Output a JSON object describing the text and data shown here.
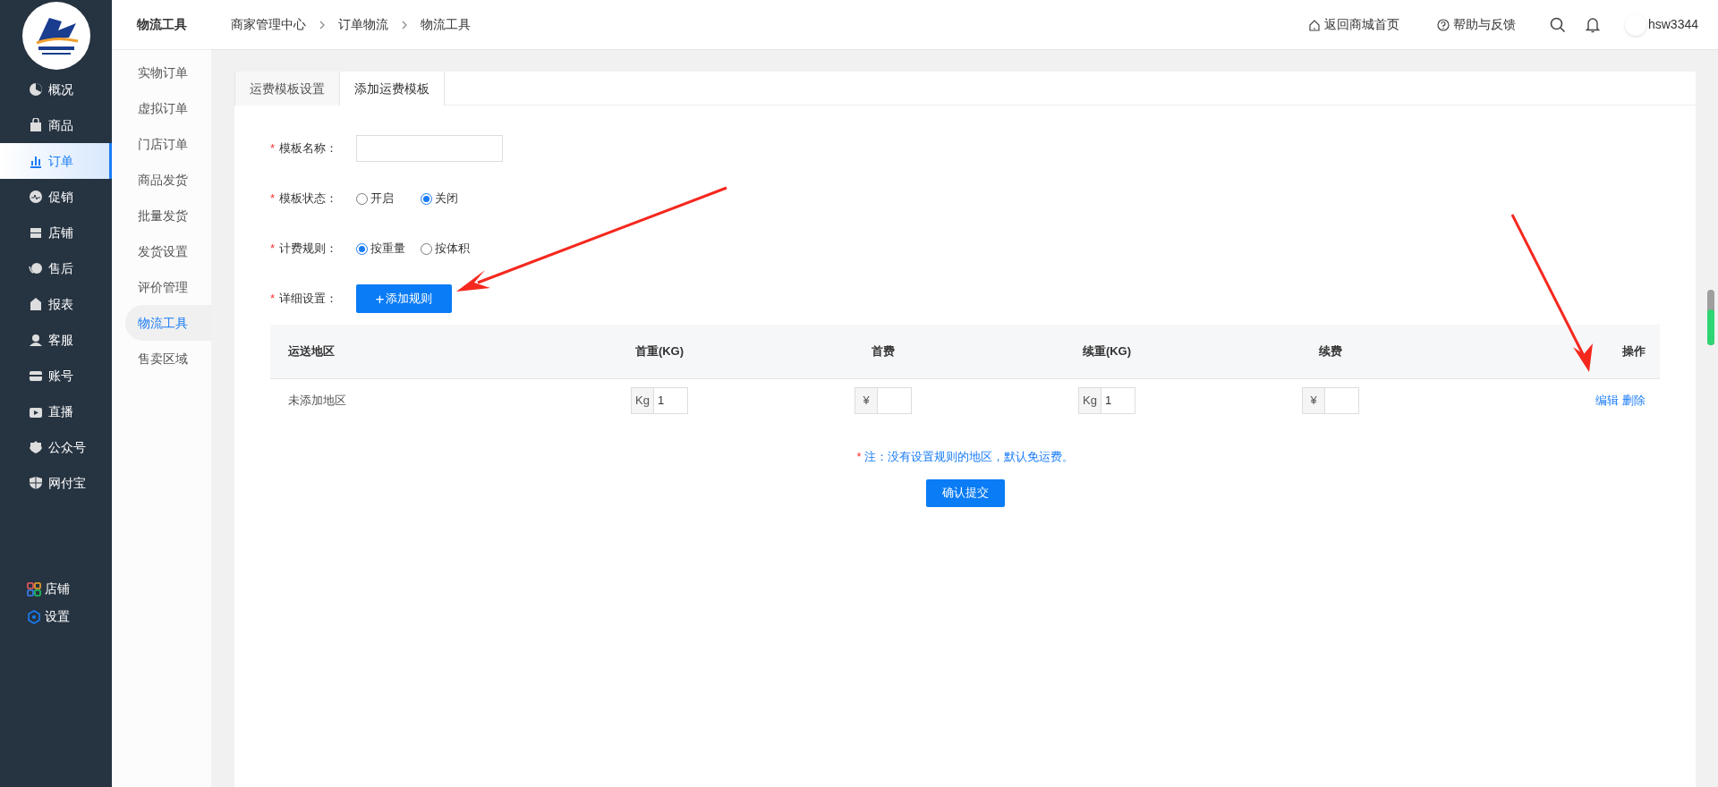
{
  "sidebar": {
    "items": [
      {
        "label": "概况",
        "selected": false
      },
      {
        "label": "商品",
        "selected": false
      },
      {
        "label": "订单",
        "selected": true
      },
      {
        "label": "促销",
        "selected": false
      },
      {
        "label": "店铺",
        "selected": false
      },
      {
        "label": "售后",
        "selected": false
      },
      {
        "label": "报表",
        "selected": false
      },
      {
        "label": "客服",
        "selected": false
      },
      {
        "label": "账号",
        "selected": false
      },
      {
        "label": "直播",
        "selected": false
      },
      {
        "label": "公众号",
        "selected": false
      },
      {
        "label": "网付宝",
        "selected": false
      }
    ],
    "bottom_items": [
      {
        "label": "店铺"
      },
      {
        "label": "设置"
      }
    ]
  },
  "submenu": {
    "title": "物流工具",
    "items": [
      {
        "label": "实物订单",
        "selected": false
      },
      {
        "label": "虚拟订单",
        "selected": false
      },
      {
        "label": "门店订单",
        "selected": false
      },
      {
        "label": "商品发货",
        "selected": false
      },
      {
        "label": "批量发货",
        "selected": false
      },
      {
        "label": "发货设置",
        "selected": false
      },
      {
        "label": "评价管理",
        "selected": false
      },
      {
        "label": "物流工具",
        "selected": true
      },
      {
        "label": "售卖区域",
        "selected": false
      }
    ]
  },
  "breadcrumb": [
    "商家管理中心",
    "订单物流",
    "物流工具"
  ],
  "top_links": [
    {
      "kind": "home",
      "label": "返回商城首页"
    },
    {
      "kind": "help",
      "label": "帮助与反馈"
    }
  ],
  "user": {
    "name": "hsw3344"
  },
  "tabs": [
    {
      "label": "运费模板设置",
      "selected": false
    },
    {
      "label": "添加运费模板",
      "selected": true
    }
  ],
  "form": [
    {
      "kind": "text",
      "mark": "*",
      "label": "模板名称："
    },
    {
      "kind": "radio",
      "mark": "*",
      "label": "模板状态：",
      "options": [
        {
          "label": "开启",
          "selected": false
        },
        {
          "label": "关闭",
          "selected": true
        }
      ]
    },
    {
      "kind": "radio",
      "mark": "*",
      "label": "计费规则：",
      "options": [
        {
          "label": "按重量",
          "selected": true
        },
        {
          "label": "按体积",
          "selected": false
        }
      ]
    },
    {
      "kind": "button",
      "mark": "*",
      "label": "详细设置：",
      "button": "添加规则",
      "icon": "+"
    }
  ],
  "table": {
    "columns": [
      "运送地区",
      "首重(KG)",
      "首费",
      "续重(KG)",
      "续费",
      "操作"
    ],
    "rows": [
      {
        "region": "未添加地区",
        "fields": [
          {
            "prefix": "Kg",
            "value": "1"
          },
          {
            "prefix": "¥"
          },
          {
            "prefix": "Kg",
            "value": "1"
          },
          {
            "prefix": "¥"
          }
        ],
        "actions": [
          "编辑",
          "删除"
        ]
      }
    ]
  },
  "note": {
    "mark": "*",
    "text": "注：没有设置规则的地区，默认免运费。"
  },
  "submit": "确认提交"
}
